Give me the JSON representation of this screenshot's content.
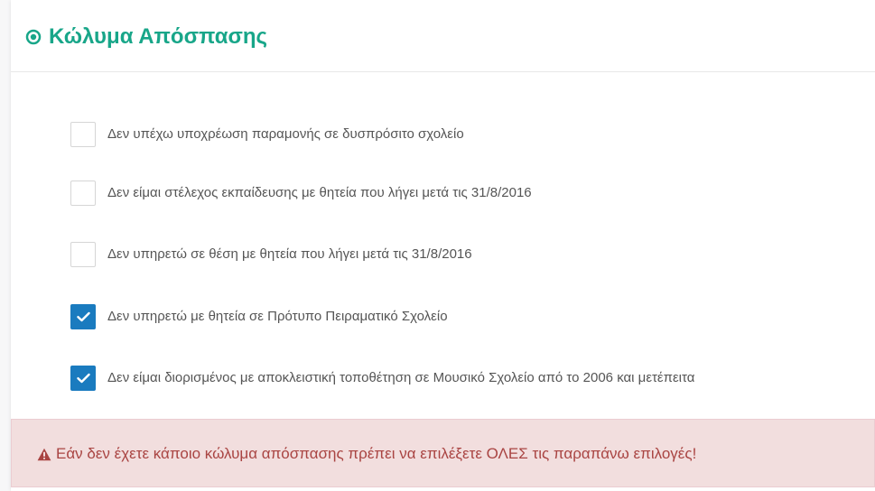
{
  "panel": {
    "title": "Κώλυμα Απόσπασης",
    "title_icon": "record-circle-icon",
    "accent_color": "#18a689"
  },
  "options": [
    {
      "label": "Δεν υπέχω υποχρέωση παραμονής σε δυσπρόσιτο σχολείο",
      "checked": false
    },
    {
      "label": "Δεν είμαι στέλεχος εκπαίδευσης με θητεία που λήγει μετά τις 31/8/2016",
      "checked": false
    },
    {
      "label": "Δεν υπηρετώ σε θέση με θητεία που λήγει μετά τις 31/8/2016",
      "checked": false
    },
    {
      "label": "Δεν υπηρετώ με θητεία σε Πρότυπο Πειραματικό Σχολείο",
      "checked": true
    },
    {
      "label": "Δεν είμαι διορισμένος με αποκλειστική τοποθέτηση σε Μουσικό Σχολείο από το 2006 και μετέπειτα",
      "checked": true
    }
  ],
  "alert": {
    "text": "Εάν δεν έχετε κάποιο κώλυμα απόσπασης πρέπει να επιλέξετε ΟΛΕΣ τις παραπάνω επιλογές!",
    "icon": "warning-triangle-icon",
    "background_color": "#f2dede",
    "text_color": "#a94442"
  },
  "checkbox_checked_color": "#1a7bbf"
}
